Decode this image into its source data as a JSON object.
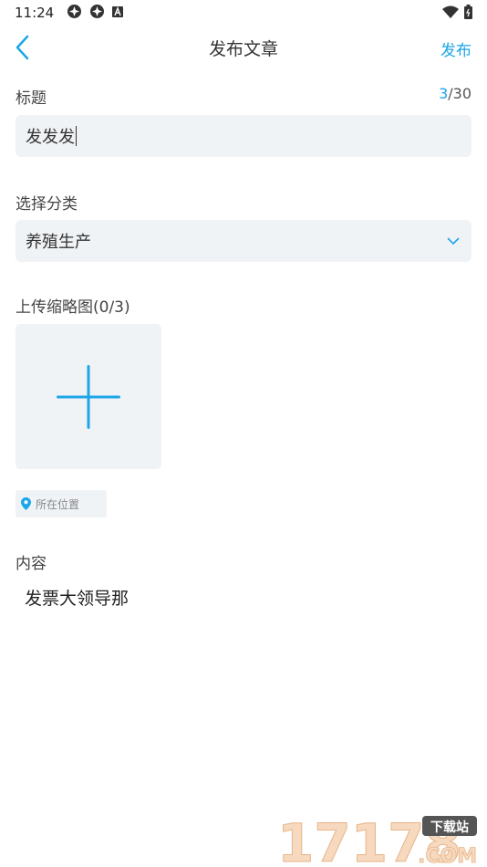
{
  "status_bar": {
    "time": "11:24",
    "icons": [
      "sync-icon",
      "sync-icon",
      "app-notification-icon",
      "wifi-icon",
      "battery-icon"
    ]
  },
  "header": {
    "title": "发布文章",
    "publish_label": "发布",
    "back_icon": "chevron-left-icon"
  },
  "form": {
    "title_label": "标题",
    "title_count_current": "3",
    "title_count_max": "/30",
    "title_value": "发发发",
    "category_label": "选择分类",
    "category_value": "养殖生产",
    "thumbnail_label": "上传缩略图(0/3)",
    "location_label": "所在位置",
    "content_label": "内容",
    "content_value": "发票大领导那"
  },
  "watermark": {
    "number": "17178",
    "badge": "下载站",
    "domain": ".COM"
  },
  "colors": {
    "accent": "#1BA6E8",
    "field_bg": "#F0F3F6",
    "text": "#333333"
  }
}
